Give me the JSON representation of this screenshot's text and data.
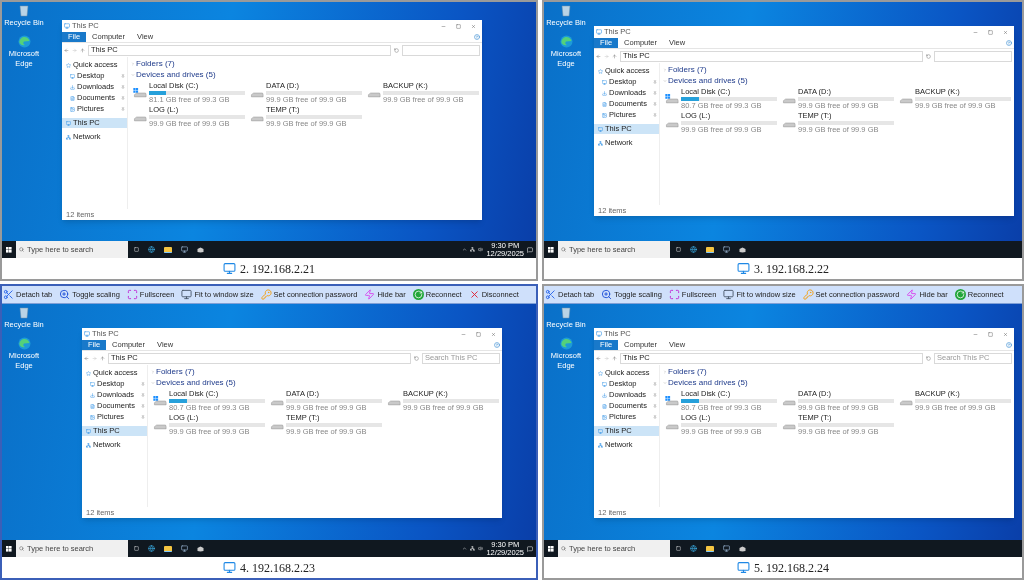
{
  "tiles": [
    {
      "label": "2. 192.168.2.21",
      "selected": false,
      "desktop_icons": [
        {
          "label": "Recycle Bin",
          "kind": "recycle"
        },
        {
          "label": "Microsoft Edge",
          "kind": "edge"
        }
      ],
      "explorer": {
        "title": "This PC",
        "ribbon_tabs": [
          {
            "label": "File",
            "selected": true
          },
          {
            "label": "Computer",
            "selected": false
          },
          {
            "label": "View",
            "selected": false
          }
        ],
        "address": "This PC",
        "nav": [
          {
            "label": "Quick access",
            "kind": "star",
            "pinned": false,
            "selected": false
          },
          {
            "label": "Desktop",
            "kind": "desktop",
            "pinned": true,
            "selected": false
          },
          {
            "label": "Downloads",
            "kind": "download",
            "pinned": true,
            "selected": false
          },
          {
            "label": "Documents",
            "kind": "document",
            "pinned": true,
            "selected": false
          },
          {
            "label": "Pictures",
            "kind": "picture",
            "pinned": true,
            "selected": false
          },
          {
            "label": "This PC",
            "kind": "pc",
            "pinned": false,
            "selected": true
          },
          {
            "label": "Network",
            "kind": "network",
            "pinned": false,
            "selected": false
          }
        ],
        "groups": [
          {
            "label": "Folders (7)",
            "expanded": false
          },
          {
            "label": "Devices and drives (5)",
            "expanded": true
          }
        ],
        "drives": [
          {
            "name": "Local Disk (C:)",
            "kind": "system",
            "level": 0.18,
            "free": "81.1 GB free of 99.3 GB"
          },
          {
            "name": "DATA (D:)",
            "kind": "disk",
            "level": 0.0,
            "free": "99.9 GB free of 99.9 GB"
          },
          {
            "name": "BACKUP (K:)",
            "kind": "disk",
            "level": 0.0,
            "free": "99.9 GB free of 99.9 GB"
          },
          {
            "name": "LOG (L:)",
            "kind": "disk",
            "level": 0.0,
            "free": "99.9 GB free of 99.9 GB"
          },
          {
            "name": "TEMP (T:)",
            "kind": "disk",
            "level": 0.0,
            "free": "99.9 GB free of 99.9 GB"
          }
        ],
        "status": "12 items"
      },
      "taskbar": {
        "search_placeholder": "Type here to search",
        "time": "9:30 PM",
        "date": "12/29/2025"
      }
    },
    {
      "label": "3. 192.168.2.22",
      "selected": false,
      "desktop_icons": [
        {
          "label": "Recycle Bin",
          "kind": "recycle"
        },
        {
          "label": "Microsoft Edge",
          "kind": "edge"
        }
      ],
      "explorer": {
        "title": "This PC",
        "ribbon_tabs": [
          {
            "label": "File",
            "selected": true
          },
          {
            "label": "Computer",
            "selected": false
          },
          {
            "label": "View",
            "selected": false
          }
        ],
        "address": "This PC",
        "nav": [
          {
            "label": "Quick access",
            "kind": "star",
            "pinned": false,
            "selected": false
          },
          {
            "label": "Desktop",
            "kind": "desktop",
            "pinned": true,
            "selected": false
          },
          {
            "label": "Downloads",
            "kind": "download",
            "pinned": true,
            "selected": false
          },
          {
            "label": "Documents",
            "kind": "document",
            "pinned": true,
            "selected": false
          },
          {
            "label": "Pictures",
            "kind": "picture",
            "pinned": true,
            "selected": false
          },
          {
            "label": "This PC",
            "kind": "pc",
            "pinned": false,
            "selected": true
          },
          {
            "label": "Network",
            "kind": "network",
            "pinned": false,
            "selected": false
          }
        ],
        "groups": [
          {
            "label": "Folders (7)",
            "expanded": false
          },
          {
            "label": "Devices and drives (5)",
            "expanded": true
          }
        ],
        "drives": [
          {
            "name": "Local Disk (C:)",
            "kind": "system",
            "level": 0.19,
            "free": "80.7 GB free of 99.3 GB"
          },
          {
            "name": "DATA (D:)",
            "kind": "disk",
            "level": 0.0,
            "free": "99.9 GB free of 99.9 GB"
          },
          {
            "name": "BACKUP (K:)",
            "kind": "disk",
            "level": 0.0,
            "free": "99.9 GB free of 99.9 GB"
          },
          {
            "name": "LOG (L:)",
            "kind": "disk",
            "level": 0.0,
            "free": "99.9 GB free of 99.9 GB"
          },
          {
            "name": "TEMP (T:)",
            "kind": "disk",
            "level": 0.0,
            "free": "99.9 GB free of 99.9 GB"
          }
        ],
        "status": "12 items"
      },
      "taskbar": {
        "search_placeholder": "Type here to search"
      }
    },
    {
      "label": "4. 192.168.2.23",
      "selected": true,
      "toolbar": [
        {
          "label": "Detach tab",
          "kind": "detach"
        },
        {
          "label": "Toggle scaling",
          "kind": "scaling"
        },
        {
          "label": "Fullscreen",
          "kind": "fullscreen"
        },
        {
          "label": "Fit to window size",
          "kind": "fit"
        },
        {
          "label": "Set connection password",
          "kind": "password"
        },
        {
          "label": "Hide bar",
          "kind": "hide"
        },
        {
          "label": "Reconnect",
          "kind": "reconnect"
        },
        {
          "label": "Disconnect",
          "kind": "disconnect"
        }
      ],
      "desktop_icons": [
        {
          "label": "Recycle Bin",
          "kind": "recycle"
        },
        {
          "label": "Microsoft Edge",
          "kind": "edge"
        }
      ],
      "explorer": {
        "title": "This PC",
        "ribbon_tabs": [
          {
            "label": "File",
            "selected": true
          },
          {
            "label": "Computer",
            "selected": false
          },
          {
            "label": "View",
            "selected": false
          }
        ],
        "address": "This PC",
        "search_placeholder": "Search This PC",
        "nav": [
          {
            "label": "Quick access",
            "kind": "star",
            "pinned": false,
            "selected": false
          },
          {
            "label": "Desktop",
            "kind": "desktop",
            "pinned": true,
            "selected": false
          },
          {
            "label": "Downloads",
            "kind": "download",
            "pinned": true,
            "selected": false
          },
          {
            "label": "Documents",
            "kind": "document",
            "pinned": true,
            "selected": false
          },
          {
            "label": "Pictures",
            "kind": "picture",
            "pinned": true,
            "selected": false
          },
          {
            "label": "This PC",
            "kind": "pc",
            "pinned": false,
            "selected": true
          },
          {
            "label": "Network",
            "kind": "network",
            "pinned": false,
            "selected": false
          }
        ],
        "groups": [
          {
            "label": "Folders (7)",
            "expanded": false
          },
          {
            "label": "Devices and drives (5)",
            "expanded": true
          }
        ],
        "drives": [
          {
            "name": "Local Disk (C:)",
            "kind": "system",
            "level": 0.19,
            "free": "80.7 GB free of 99.3 GB"
          },
          {
            "name": "DATA (D:)",
            "kind": "disk",
            "level": 0.0,
            "free": "99.9 GB free of 99.9 GB"
          },
          {
            "name": "BACKUP (K:)",
            "kind": "disk",
            "level": 0.0,
            "free": "99.9 GB free of 99.9 GB"
          },
          {
            "name": "LOG (L:)",
            "kind": "disk",
            "level": 0.0,
            "free": "99.9 GB free of 99.9 GB"
          },
          {
            "name": "TEMP (T:)",
            "kind": "disk",
            "level": 0.0,
            "free": "99.9 GB free of 99.9 GB"
          }
        ],
        "status": "12 items"
      },
      "taskbar": {
        "search_placeholder": "Type here to search",
        "time": "9:30 PM",
        "date": "12/29/2025"
      }
    },
    {
      "label": "5. 192.168.2.24",
      "selected": false,
      "toolbar": [
        {
          "label": "Detach tab",
          "kind": "detach"
        },
        {
          "label": "Toggle scaling",
          "kind": "scaling"
        },
        {
          "label": "Fullscreen",
          "kind": "fullscreen"
        },
        {
          "label": "Fit to window size",
          "kind": "fit"
        },
        {
          "label": "Set connection password",
          "kind": "password"
        },
        {
          "label": "Hide bar",
          "kind": "hide"
        },
        {
          "label": "Reconnect",
          "kind": "reconnect"
        }
      ],
      "desktop_icons": [
        {
          "label": "Recycle Bin",
          "kind": "recycle"
        },
        {
          "label": "Microsoft Edge",
          "kind": "edge"
        }
      ],
      "explorer": {
        "title": "This PC",
        "ribbon_tabs": [
          {
            "label": "File",
            "selected": true
          },
          {
            "label": "Computer",
            "selected": false
          },
          {
            "label": "View",
            "selected": false
          }
        ],
        "address": "This PC",
        "search_placeholder": "Search This PC",
        "nav": [
          {
            "label": "Quick access",
            "kind": "star",
            "pinned": false,
            "selected": false
          },
          {
            "label": "Desktop",
            "kind": "desktop",
            "pinned": true,
            "selected": false
          },
          {
            "label": "Downloads",
            "kind": "download",
            "pinned": true,
            "selected": false
          },
          {
            "label": "Documents",
            "kind": "document",
            "pinned": true,
            "selected": false
          },
          {
            "label": "Pictures",
            "kind": "picture",
            "pinned": true,
            "selected": false
          },
          {
            "label": "This PC",
            "kind": "pc",
            "pinned": false,
            "selected": true
          },
          {
            "label": "Network",
            "kind": "network",
            "pinned": false,
            "selected": false
          }
        ],
        "groups": [
          {
            "label": "Folders (7)",
            "expanded": false
          },
          {
            "label": "Devices and drives (5)",
            "expanded": true
          }
        ],
        "drives": [
          {
            "name": "Local Disk (C:)",
            "kind": "system",
            "level": 0.19,
            "free": "80.7 GB free of 99.3 GB"
          },
          {
            "name": "DATA (D:)",
            "kind": "disk",
            "level": 0.0,
            "free": "99.9 GB free of 99.9 GB"
          },
          {
            "name": "BACKUP (K:)",
            "kind": "disk",
            "level": 0.0,
            "free": "99.9 GB free of 99.9 GB"
          },
          {
            "name": "LOG (L:)",
            "kind": "disk",
            "level": 0.0,
            "free": "99.9 GB free of 99.9 GB"
          },
          {
            "name": "TEMP (T:)",
            "kind": "disk",
            "level": 0.0,
            "free": "99.9 GB free of 99.9 GB"
          }
        ],
        "status": "12 items"
      },
      "taskbar": {
        "search_placeholder": "Type here to search"
      }
    }
  ]
}
